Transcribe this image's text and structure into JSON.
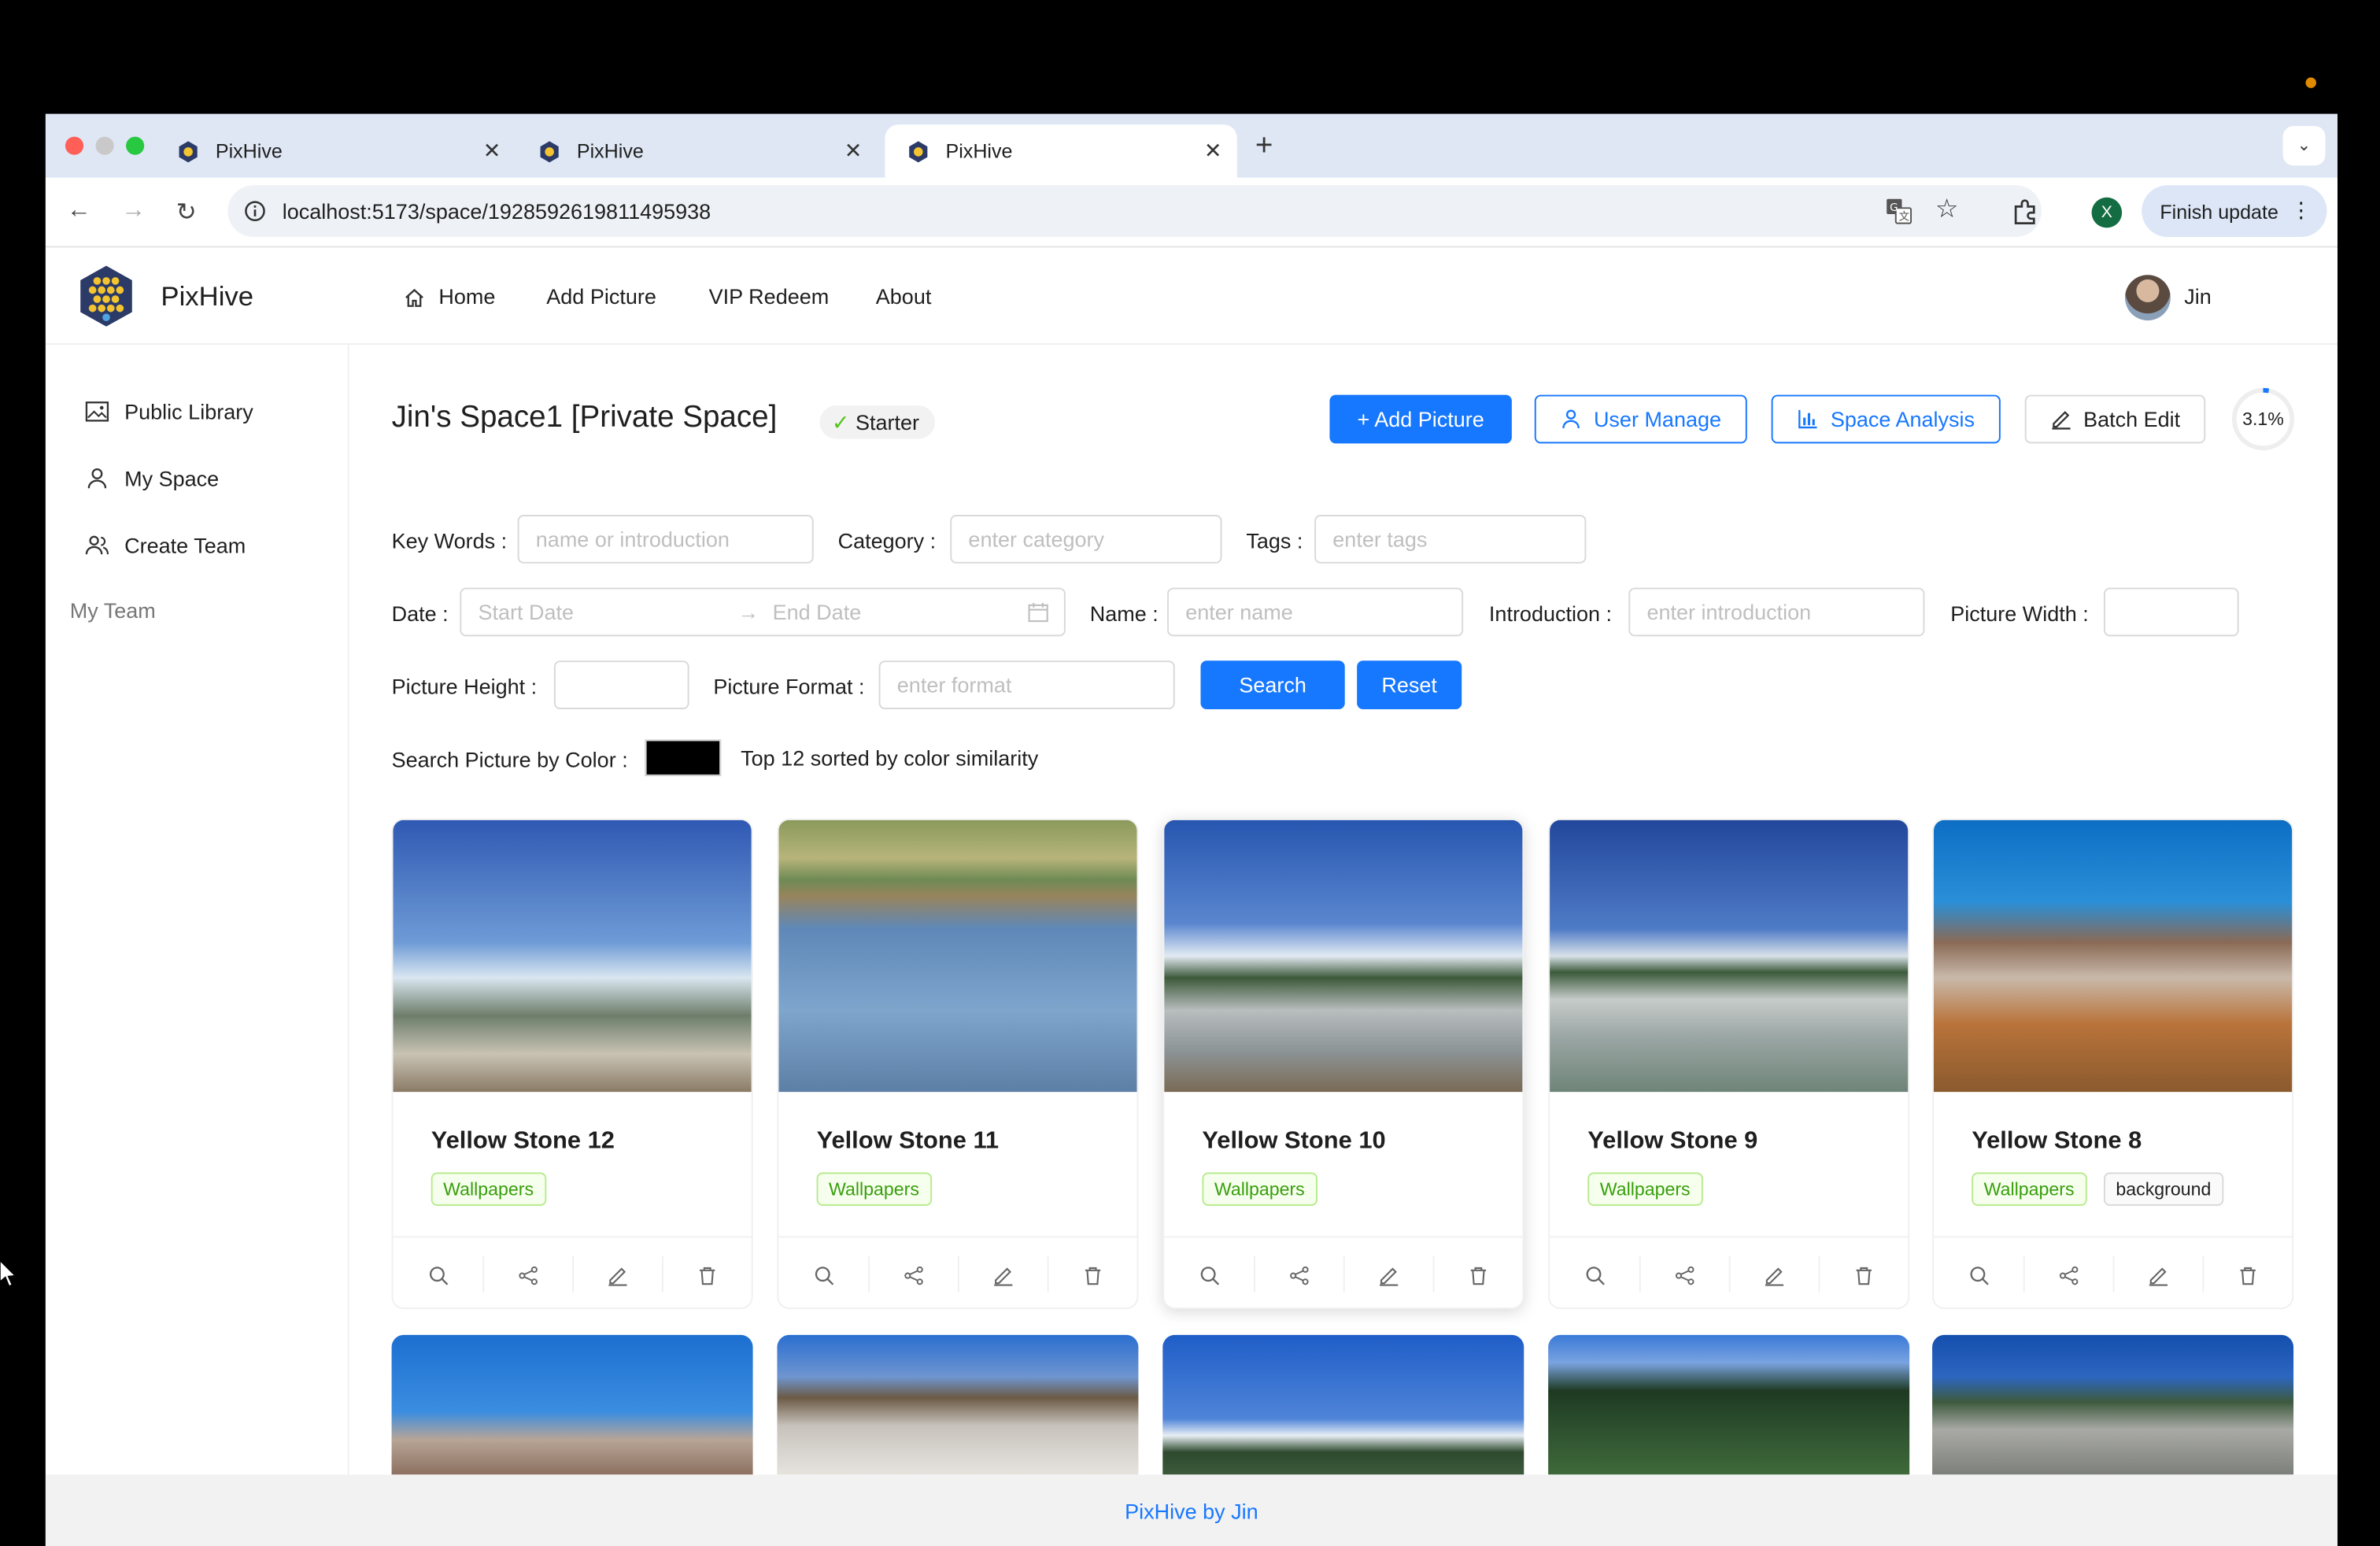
{
  "browser": {
    "tabs": [
      {
        "title": "PixHive"
      },
      {
        "title": "PixHive"
      },
      {
        "title": "PixHive"
      }
    ],
    "new_tab": "+",
    "url": "localhost:5173/space/1928592619811495938",
    "profile_initial": "X",
    "finish_update": "Finish update"
  },
  "app": {
    "name": "PixHive",
    "menu": [
      "Home",
      "Add Picture",
      "VIP Redeem",
      "About"
    ],
    "user": "Jin"
  },
  "sidebar": {
    "items": [
      "Public Library",
      "My Space",
      "Create Team"
    ],
    "section": "My Team"
  },
  "space": {
    "title": "Jin's Space1 [Private Space]",
    "level": "Starter",
    "usage": "3.1%",
    "usage_fraction": 0.031
  },
  "buttons": {
    "add_picture": "+ Add Picture",
    "user_manage": "User Manage",
    "space_analysis": "Space Analysis",
    "batch_edit": "Batch Edit",
    "search": "Search",
    "reset": "Reset"
  },
  "filters": {
    "keywords": {
      "label": "Key Words",
      "placeholder": "name or introduction"
    },
    "category": {
      "label": "Category",
      "placeholder": "enter category"
    },
    "tags": {
      "label": "Tags",
      "placeholder": "enter tags"
    },
    "date": {
      "label": "Date",
      "start": "Start Date",
      "end": "End Date"
    },
    "name": {
      "label": "Name",
      "placeholder": "enter name"
    },
    "introduction": {
      "label": "Introduction",
      "placeholder": "enter introduction"
    },
    "width": {
      "label": "Picture Width"
    },
    "height": {
      "label": "Picture Height"
    },
    "format": {
      "label": "Picture Format",
      "placeholder": "enter format"
    },
    "color": {
      "label": "Search Picture by Color",
      "value": "#000000",
      "hint": "Top 12 sorted by color similarity"
    }
  },
  "pictures": [
    {
      "name": "Yellow Stone 12",
      "tags": [
        "Wallpapers"
      ]
    },
    {
      "name": "Yellow Stone 11",
      "tags": [
        "Wallpapers"
      ]
    },
    {
      "name": "Yellow Stone 10",
      "tags": [
        "Wallpapers"
      ]
    },
    {
      "name": "Yellow Stone 9",
      "tags": [
        "Wallpapers"
      ]
    },
    {
      "name": "Yellow Stone 8",
      "tags": [
        "Wallpapers",
        "background"
      ]
    }
  ],
  "footer": "PixHive by Jin",
  "colors": {
    "primary": "#1677ff",
    "tag_green": "#389e0d"
  }
}
